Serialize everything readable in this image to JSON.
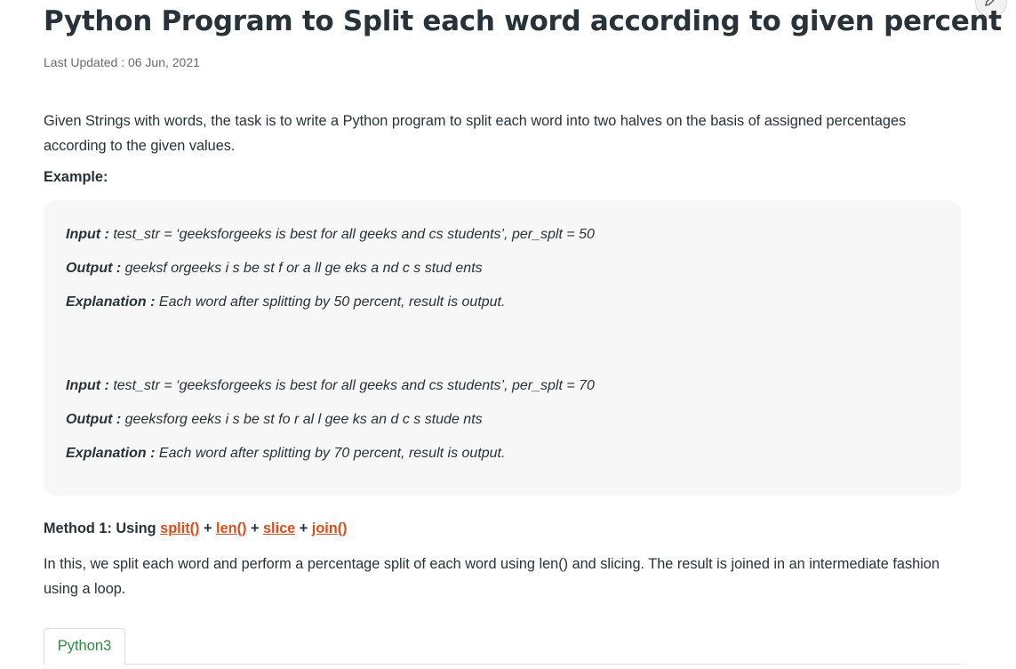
{
  "article": {
    "title": "Python Program to Split each word according to given percent",
    "last_updated": "Last Updated : 06 Jun, 2021",
    "intro": "Given Strings with words, the task is to write a Python program to split each word into two halves on the basis of assigned percentages according to the given values.",
    "example_label": "Example:",
    "examples": [
      {
        "input_label": "Input :",
        "input": "test_str = ‘geeksforgeeks is best for all geeks and cs students’, per_splt = 50",
        "output_label": "Output :",
        "output": "geeksf orgeeks i s be st f or a ll ge eks a nd c s stud ents",
        "explanation_label": "Explanation :",
        "explanation": "Each word after splitting by 50 percent, result is output."
      },
      {
        "input_label": "Input :",
        "input": "test_str = ‘geeksforgeeks is best for all geeks and cs students’, per_splt = 70",
        "output_label": "Output :",
        "output": "geeksforg eeks i s be st fo r al l gee ks an d c s stude nts",
        "explanation_label": "Explanation :",
        "explanation": "Each word after splitting by 70 percent, result is output."
      }
    ],
    "method": {
      "prefix": "Method 1: Using",
      "links": [
        "split()",
        "len()",
        "slice",
        "join()"
      ],
      "separator": "+"
    },
    "method_description": "In this, we split each word and perform a percentage split of each word using len() and slicing. The result is joined in an intermediate fashion using a loop.",
    "code_tab": "Python3"
  },
  "colors": {
    "link": "#d94f1e",
    "tab_text": "#2f8d46",
    "example_bg": "#f7f7f7",
    "text": "#273239"
  },
  "icons": {
    "edit": "pencil-icon"
  }
}
